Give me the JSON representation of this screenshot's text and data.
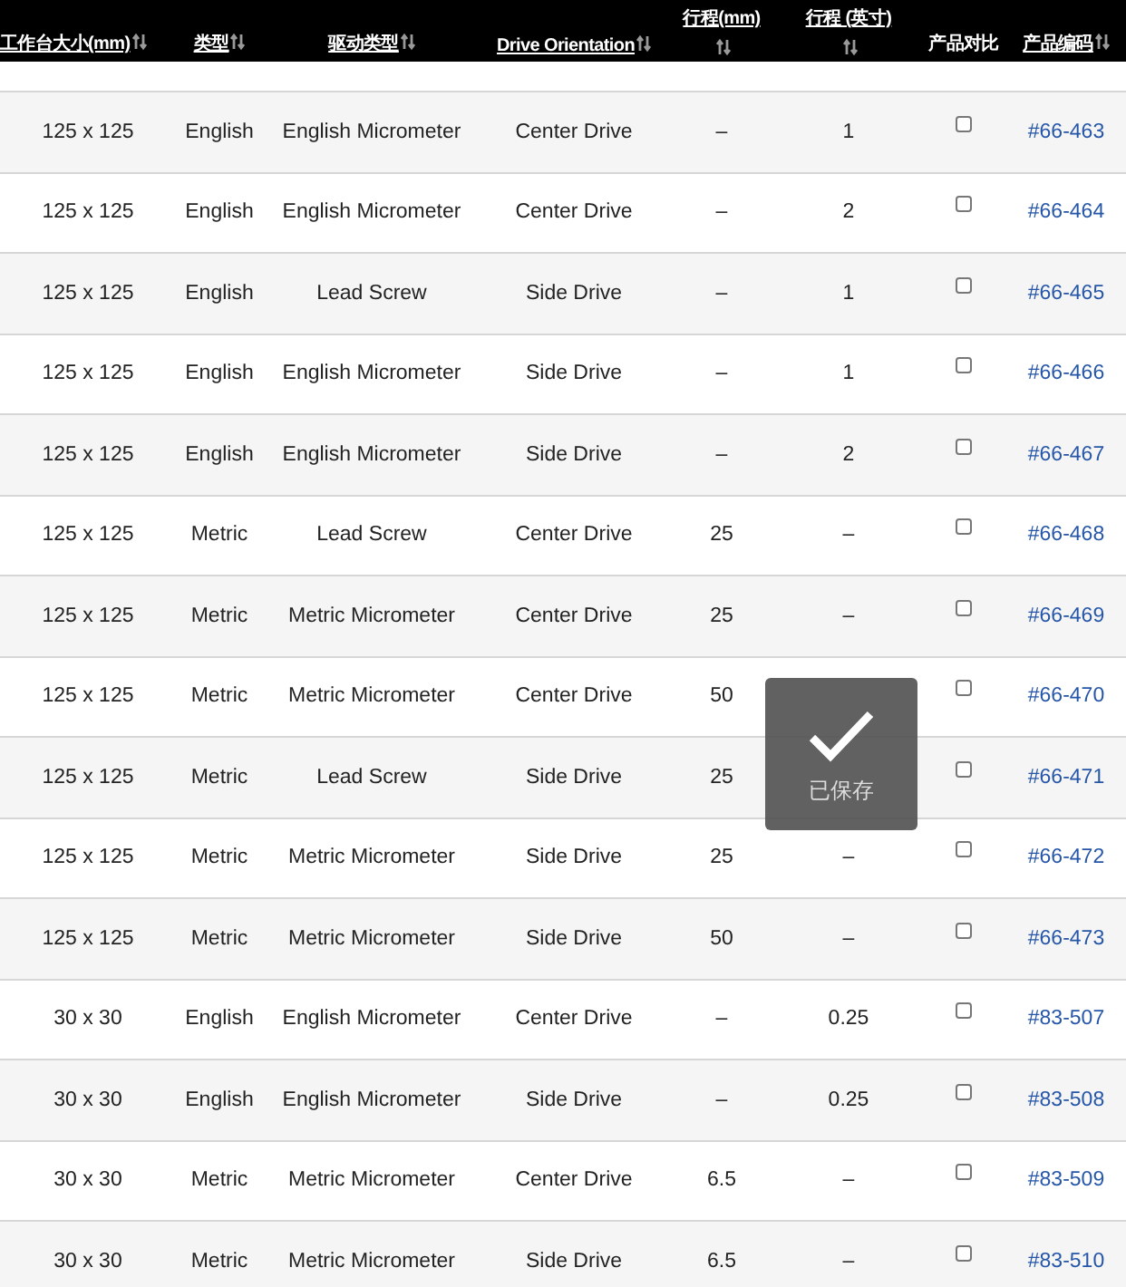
{
  "table": {
    "columns": [
      {
        "label": "工作台大小(mm)",
        "sortable": true
      },
      {
        "label": "类型",
        "sortable": true
      },
      {
        "label": "驱动类型",
        "sortable": true
      },
      {
        "label": "Drive Orientation",
        "sortable": true
      },
      {
        "label": "行程(mm)",
        "sortable": true
      },
      {
        "label": "行程 (英寸)",
        "sortable": true
      },
      {
        "label": "产品对比",
        "sortable": false
      },
      {
        "label": "产品编码",
        "sortable": true
      }
    ],
    "rows": [
      {
        "cells": [
          "125 x 125",
          "English",
          "English Micrometer",
          "Center Drive",
          "–",
          "1"
        ],
        "compare": false,
        "code": "#66-463"
      },
      {
        "cells": [
          "125 x 125",
          "English",
          "English Micrometer",
          "Center Drive",
          "–",
          "2"
        ],
        "compare": false,
        "code": "#66-464"
      },
      {
        "cells": [
          "125 x 125",
          "English",
          "Lead Screw",
          "Side Drive",
          "–",
          "1"
        ],
        "compare": false,
        "code": "#66-465"
      },
      {
        "cells": [
          "125 x 125",
          "English",
          "English Micrometer",
          "Side Drive",
          "–",
          "1"
        ],
        "compare": false,
        "code": "#66-466"
      },
      {
        "cells": [
          "125 x 125",
          "English",
          "English Micrometer",
          "Side Drive",
          "–",
          "2"
        ],
        "compare": false,
        "code": "#66-467"
      },
      {
        "cells": [
          "125 x 125",
          "Metric",
          "Lead Screw",
          "Center Drive",
          "25",
          "–"
        ],
        "compare": false,
        "code": "#66-468"
      },
      {
        "cells": [
          "125 x 125",
          "Metric",
          "Metric Micrometer",
          "Center Drive",
          "25",
          "–"
        ],
        "compare": false,
        "code": "#66-469"
      },
      {
        "cells": [
          "125 x 125",
          "Metric",
          "Metric Micrometer",
          "Center Drive",
          "50"
        ],
        "compare": false,
        "code": "#66-470"
      },
      {
        "cells": [
          "125 x 125",
          "Metric",
          "Lead Screw",
          "Side Drive",
          "25"
        ],
        "compare": false,
        "code": "#66-471"
      },
      {
        "cells": [
          "125 x 125",
          "Metric",
          "Metric Micrometer",
          "Side Drive",
          "25",
          "–"
        ],
        "compare": false,
        "code": "#66-472"
      },
      {
        "cells": [
          "125 x 125",
          "Metric",
          "Metric Micrometer",
          "Side Drive",
          "50",
          "–"
        ],
        "compare": false,
        "code": "#66-473"
      },
      {
        "cells": [
          "30 x 30",
          "English",
          "English Micrometer",
          "Center Drive",
          "–",
          "0.25"
        ],
        "compare": false,
        "code": "#83-507"
      },
      {
        "cells": [
          "30 x 30",
          "English",
          "English Micrometer",
          "Side Drive",
          "–",
          "0.25"
        ],
        "compare": false,
        "code": "#83-508"
      },
      {
        "cells": [
          "30 x 30",
          "Metric",
          "Metric Micrometer",
          "Center Drive",
          "6.5",
          "–"
        ],
        "compare": false,
        "code": "#83-509"
      },
      {
        "cells": [
          "30 x 30",
          "Metric",
          "Metric Micrometer",
          "Side Drive",
          "6.5",
          "–"
        ],
        "compare": false,
        "code": "#83-510"
      }
    ]
  },
  "toast": {
    "message": "已保存"
  }
}
